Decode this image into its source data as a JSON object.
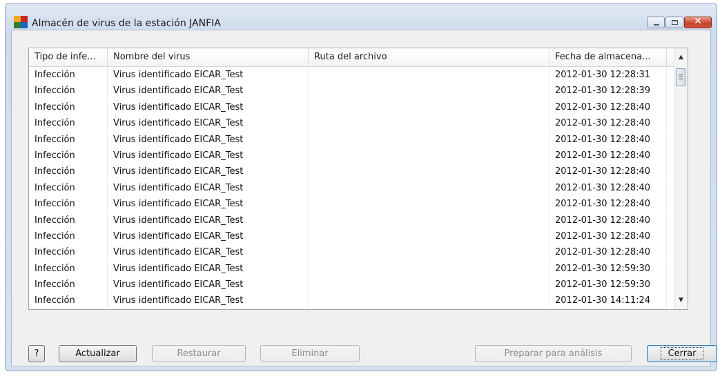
{
  "window": {
    "title": "Almacén de virus de la estación JANFIA",
    "controls": {
      "minimize": "minimize-button",
      "maximize": "maximize-button",
      "close": "close-button"
    }
  },
  "table": {
    "columns": [
      "Tipo de infe...",
      "Nombre del virus",
      "Ruta del archivo",
      "Fecha de almacena..."
    ],
    "rows": [
      [
        "Infección",
        "Virus identificado EICAR_Test",
        "",
        "2012-01-30 12:28:31"
      ],
      [
        "Infección",
        "Virus identificado EICAR_Test",
        "",
        "2012-01-30 12:28:39"
      ],
      [
        "Infección",
        "Virus identificado EICAR_Test",
        "",
        "2012-01-30 12:28:40"
      ],
      [
        "Infección",
        "Virus identificado EICAR_Test",
        "",
        "2012-01-30 12:28:40"
      ],
      [
        "Infección",
        "Virus identificado EICAR_Test",
        "",
        "2012-01-30 12:28:40"
      ],
      [
        "Infección",
        "Virus identificado EICAR_Test",
        "",
        "2012-01-30 12:28:40"
      ],
      [
        "Infección",
        "Virus identificado EICAR_Test",
        "",
        "2012-01-30 12:28:40"
      ],
      [
        "Infección",
        "Virus identificado EICAR_Test",
        "",
        "2012-01-30 12:28:40"
      ],
      [
        "Infección",
        "Virus identificado EICAR_Test",
        "",
        "2012-01-30 12:28:40"
      ],
      [
        "Infección",
        "Virus identificado EICAR_Test",
        "",
        "2012-01-30 12:28:40"
      ],
      [
        "Infección",
        "Virus identificado EICAR_Test",
        "",
        "2012-01-30 12:28:40"
      ],
      [
        "Infección",
        "Virus identificado EICAR_Test",
        "",
        "2012-01-30 12:28:40"
      ],
      [
        "Infección",
        "Virus identificado EICAR_Test",
        "",
        "2012-01-30 12:59:30"
      ],
      [
        "Infección",
        "Virus identificado EICAR_Test",
        "",
        "2012-01-30 12:59:30"
      ],
      [
        "Infección",
        "Virus identificado EICAR_Test",
        "",
        "2012-01-30 14:11:24"
      ]
    ]
  },
  "buttons": {
    "help": "?",
    "refresh": "Actualizar",
    "restore": "Restaurar",
    "delete": "Eliminar",
    "prepare": "Preparar para análisis",
    "close": "Cerrar"
  },
  "colors": {
    "title_bar": "#d6e2ef",
    "close_button": "#c7432a",
    "default_button_border": "#3c7fb1"
  }
}
